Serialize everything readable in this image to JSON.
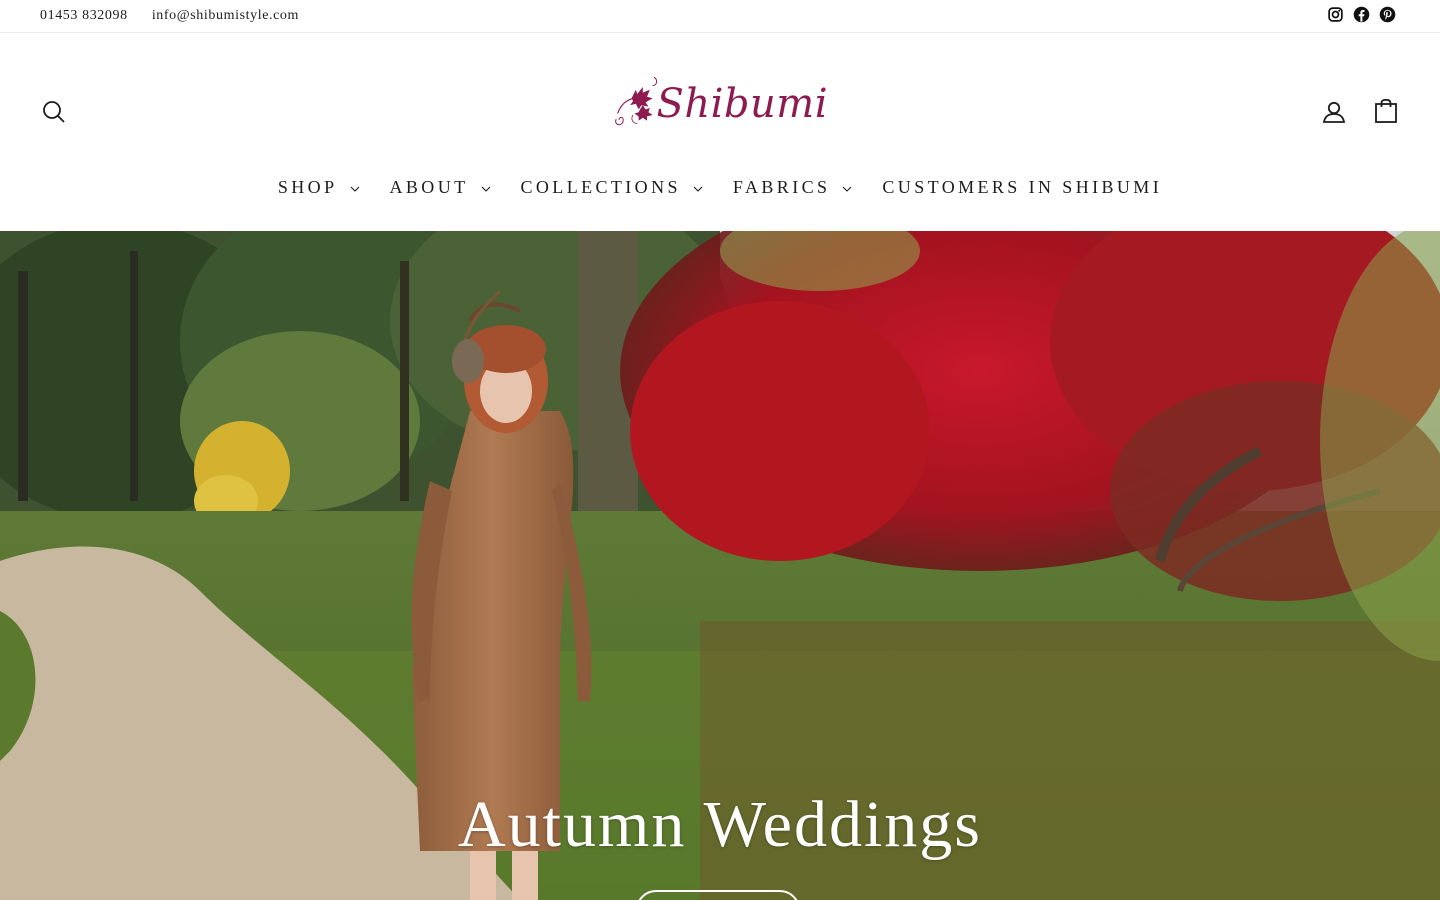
{
  "topbar": {
    "phone": "01453 832098",
    "email": "info@shibumistyle.com",
    "social": [
      "instagram-icon",
      "facebook-icon",
      "pinterest-icon"
    ]
  },
  "header": {
    "logo_text": "Shibumi",
    "brand_color": "#8e1b4f",
    "icons": [
      "search-icon",
      "user-icon",
      "bag-icon"
    ]
  },
  "nav": {
    "items": [
      {
        "label": "SHOP",
        "has_dropdown": true
      },
      {
        "label": "ABOUT",
        "has_dropdown": true
      },
      {
        "label": "COLLECTIONS",
        "has_dropdown": true
      },
      {
        "label": "FABRICS",
        "has_dropdown": true
      },
      {
        "label": "CUSTOMERS IN SHIBUMI",
        "has_dropdown": false
      }
    ]
  },
  "hero": {
    "title": "Autumn Weddings"
  }
}
